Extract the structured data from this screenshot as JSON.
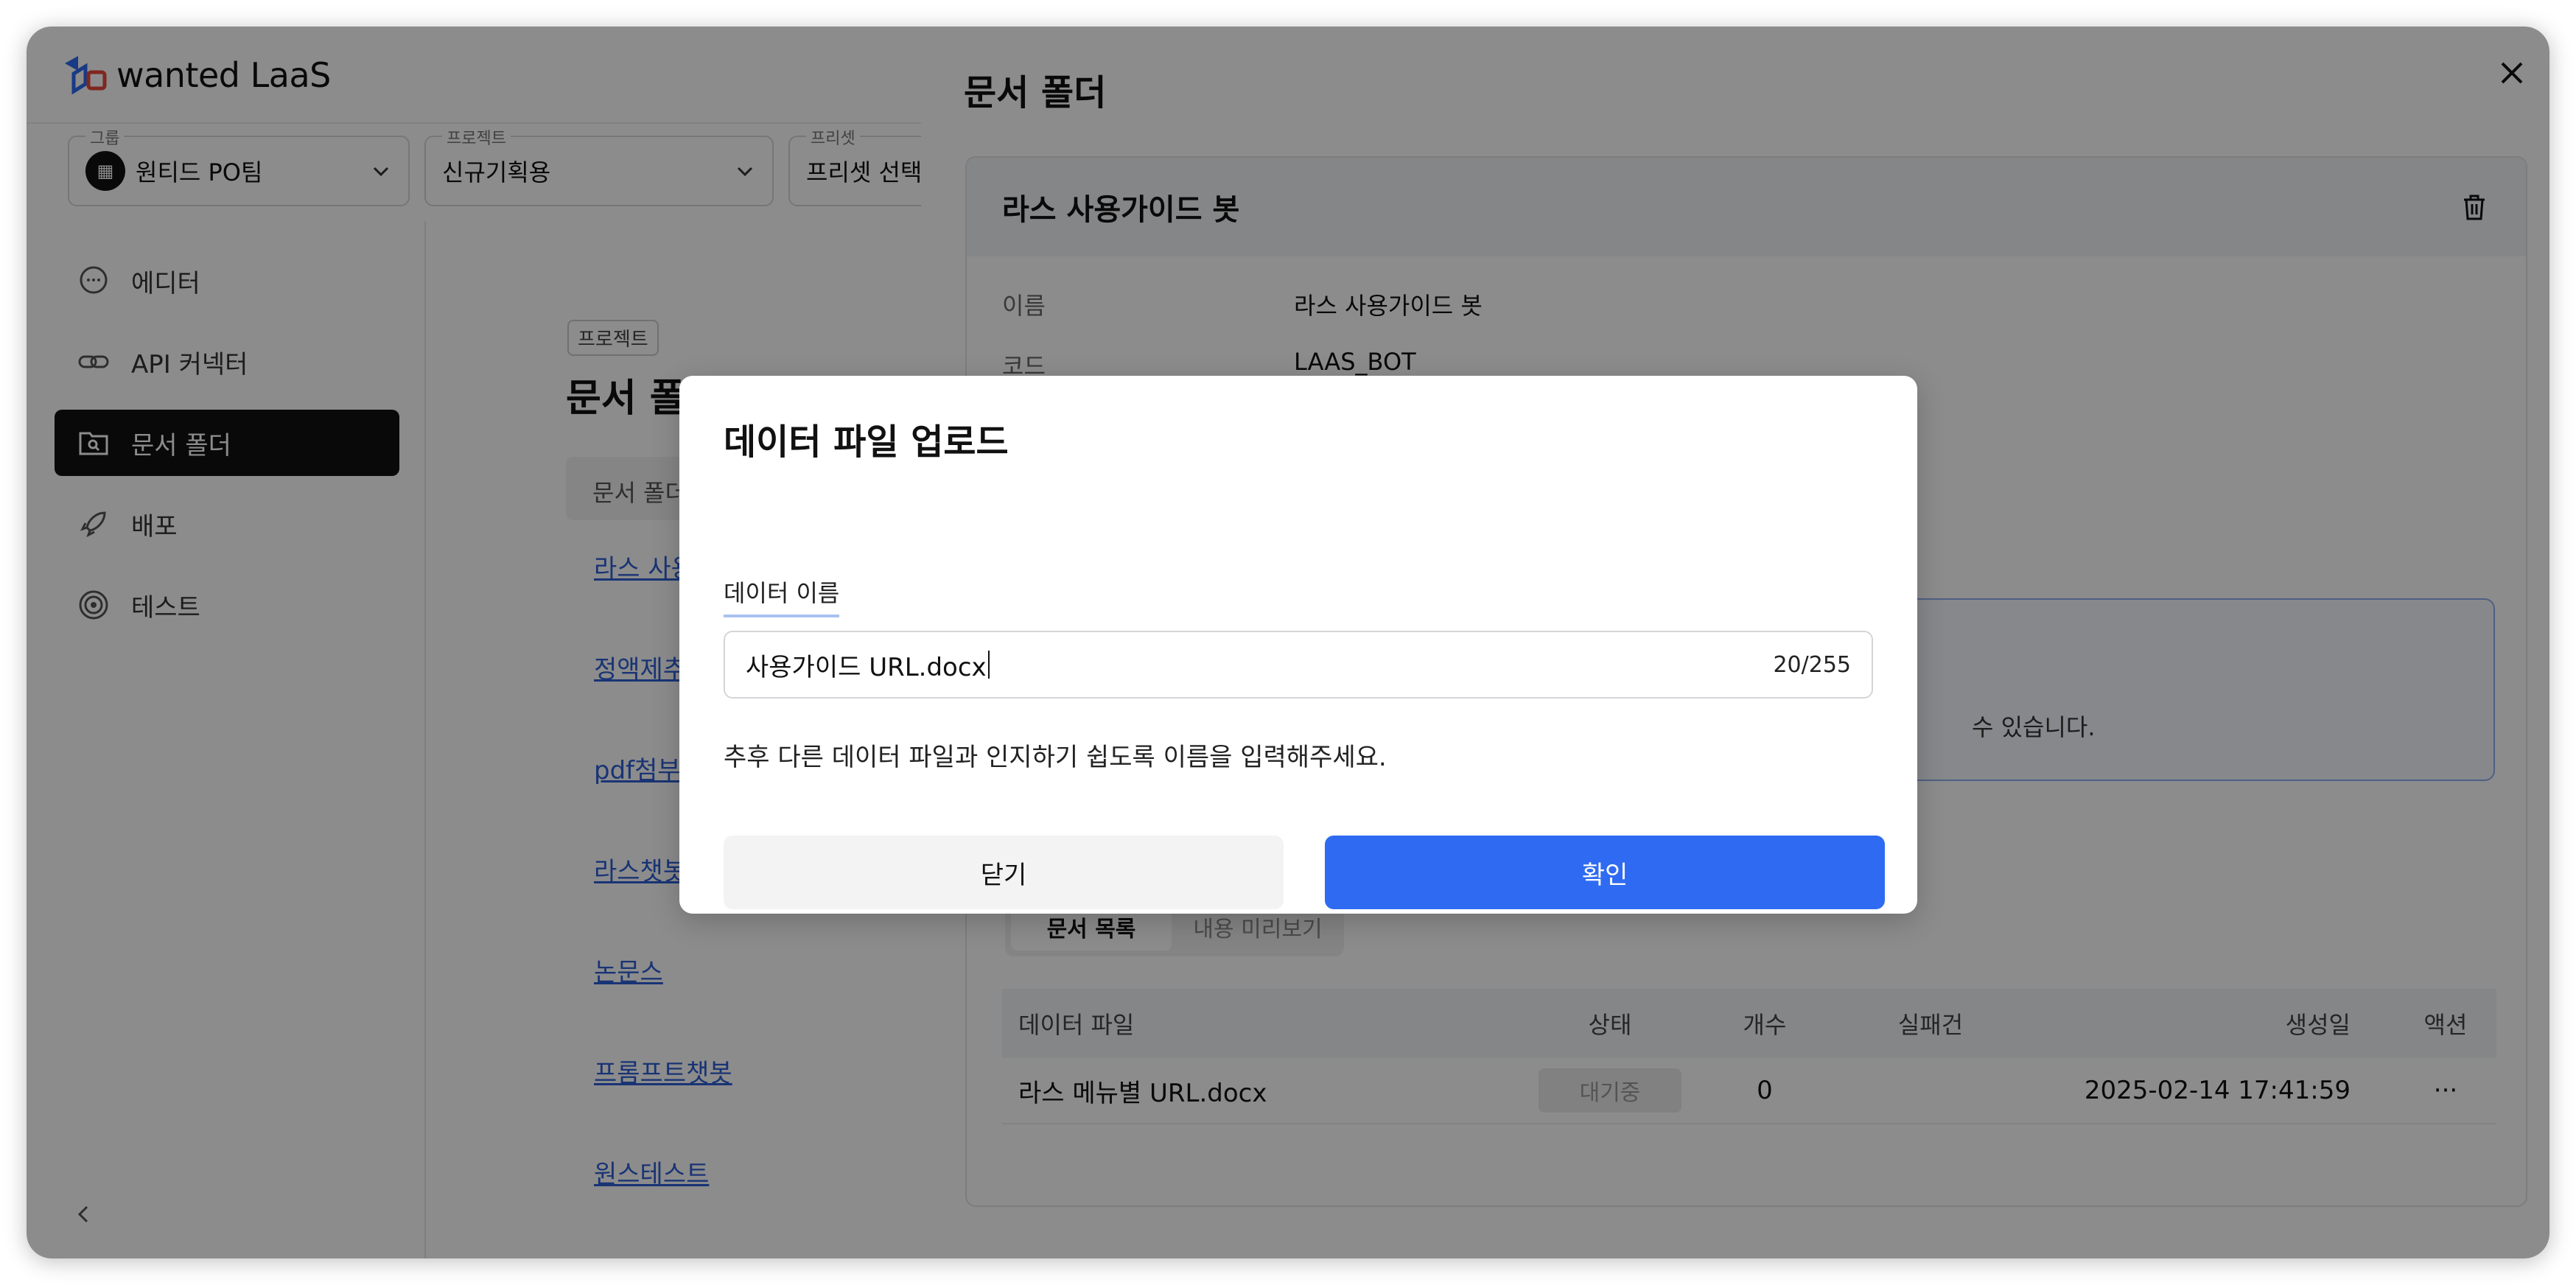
{
  "app": {
    "logo_text": "wanted LaaS",
    "selectors": {
      "group": {
        "caption": "그룹",
        "value": "원티드 PO팀"
      },
      "project": {
        "caption": "프로젝트",
        "value": "신규기획용"
      },
      "preset": {
        "caption": "프리셋",
        "value": "프리셋 선택"
      }
    },
    "nav": [
      {
        "label": "에디터",
        "icon": "chat-bubble-icon"
      },
      {
        "label": "API 커넥터",
        "icon": "link-icon"
      },
      {
        "label": "문서 폴더",
        "icon": "folder-search-icon",
        "active": true
      },
      {
        "label": "배포",
        "icon": "rocket-icon"
      },
      {
        "label": "테스트",
        "icon": "target-icon"
      }
    ]
  },
  "main": {
    "section_tag": "프로젝트",
    "title": "문서 폴더",
    "tab": "문서 폴더",
    "list": [
      "라스 사용가이드 봇",
      "정액제추천봇",
      "pdf첨부파일",
      "라스챗봇",
      "논문스",
      "프롬프트챗봇",
      "원스테스트"
    ]
  },
  "drawer": {
    "title": "문서 폴더",
    "card_title": "라스 사용가이드 봇",
    "info": [
      {
        "key": "이름",
        "value": "라스 사용가이드 봇"
      },
      {
        "key": "코드",
        "value": "LAAS_BOT"
      }
    ],
    "notice_text": "수 있습니다.",
    "segments": [
      "문서 목록",
      "내용 미리보기"
    ],
    "table": {
      "headers": [
        "데이터 파일",
        "상태",
        "개수",
        "실패건",
        "생성일",
        "액션"
      ],
      "rows": [
        {
          "file": "라스 메뉴별 URL.docx",
          "status": "대기중",
          "count": "0",
          "failed": "",
          "created": "2025-02-14 17:41:59",
          "action": "···"
        }
      ]
    }
  },
  "modal": {
    "title": "데이터 파일 업로드",
    "field_label": "데이터 이름",
    "field_value": "사용가이드 URL.docx",
    "field_counter": "20/255",
    "helper": "추후 다른 데이터 파일과 인지하기 쉽도록 이름을 입력해주세요.",
    "cancel_label": "닫기",
    "confirm_label": "확인"
  },
  "colors": {
    "primary": "#2f6bf2",
    "overlay": "rgba(0,0,0,0.45)",
    "link": "#2f5fd6",
    "nav_active_bg": "#111111"
  }
}
